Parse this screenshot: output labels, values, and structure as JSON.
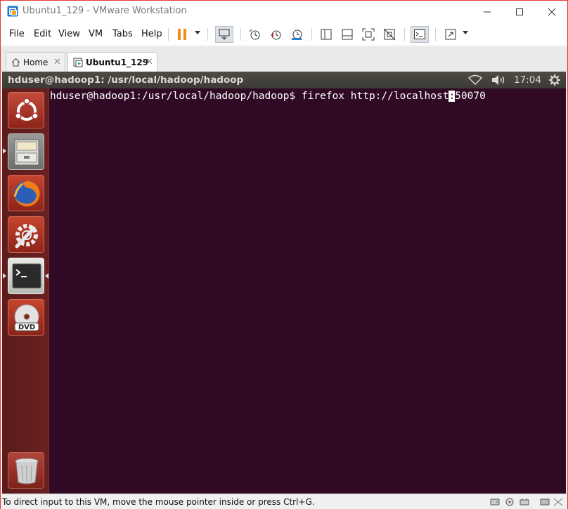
{
  "window": {
    "title": "Ubuntu1_129 - VMware Workstation",
    "accent": "#e03a3a"
  },
  "menu": {
    "items": [
      "File",
      "Edit",
      "View",
      "VM",
      "Tabs",
      "Help"
    ]
  },
  "tabs": [
    {
      "label": "Home",
      "icon": "home-icon",
      "selected": false
    },
    {
      "label": "Ubuntu1_129",
      "icon": "vm-icon",
      "selected": true
    }
  ],
  "guest": {
    "topbar_title": "hduser@hadoop1: /usr/local/hadoop/hadoop",
    "clock": "17:04",
    "background": "#300a24",
    "launcher_items": [
      "ubuntu-dash",
      "files",
      "firefox",
      "system-settings",
      "terminal",
      "dvd"
    ],
    "trash": "trash"
  },
  "terminal": {
    "prompt": "hduser@hadoop1:/usr/local/hadoop/hadoop$ ",
    "command_before_cursor": "firefox http://localhost",
    "cursor_char": ":",
    "command_after_cursor": "50070"
  },
  "status": {
    "message": "To direct input to this VM, move the mouse pointer inside or press Ctrl+G."
  }
}
